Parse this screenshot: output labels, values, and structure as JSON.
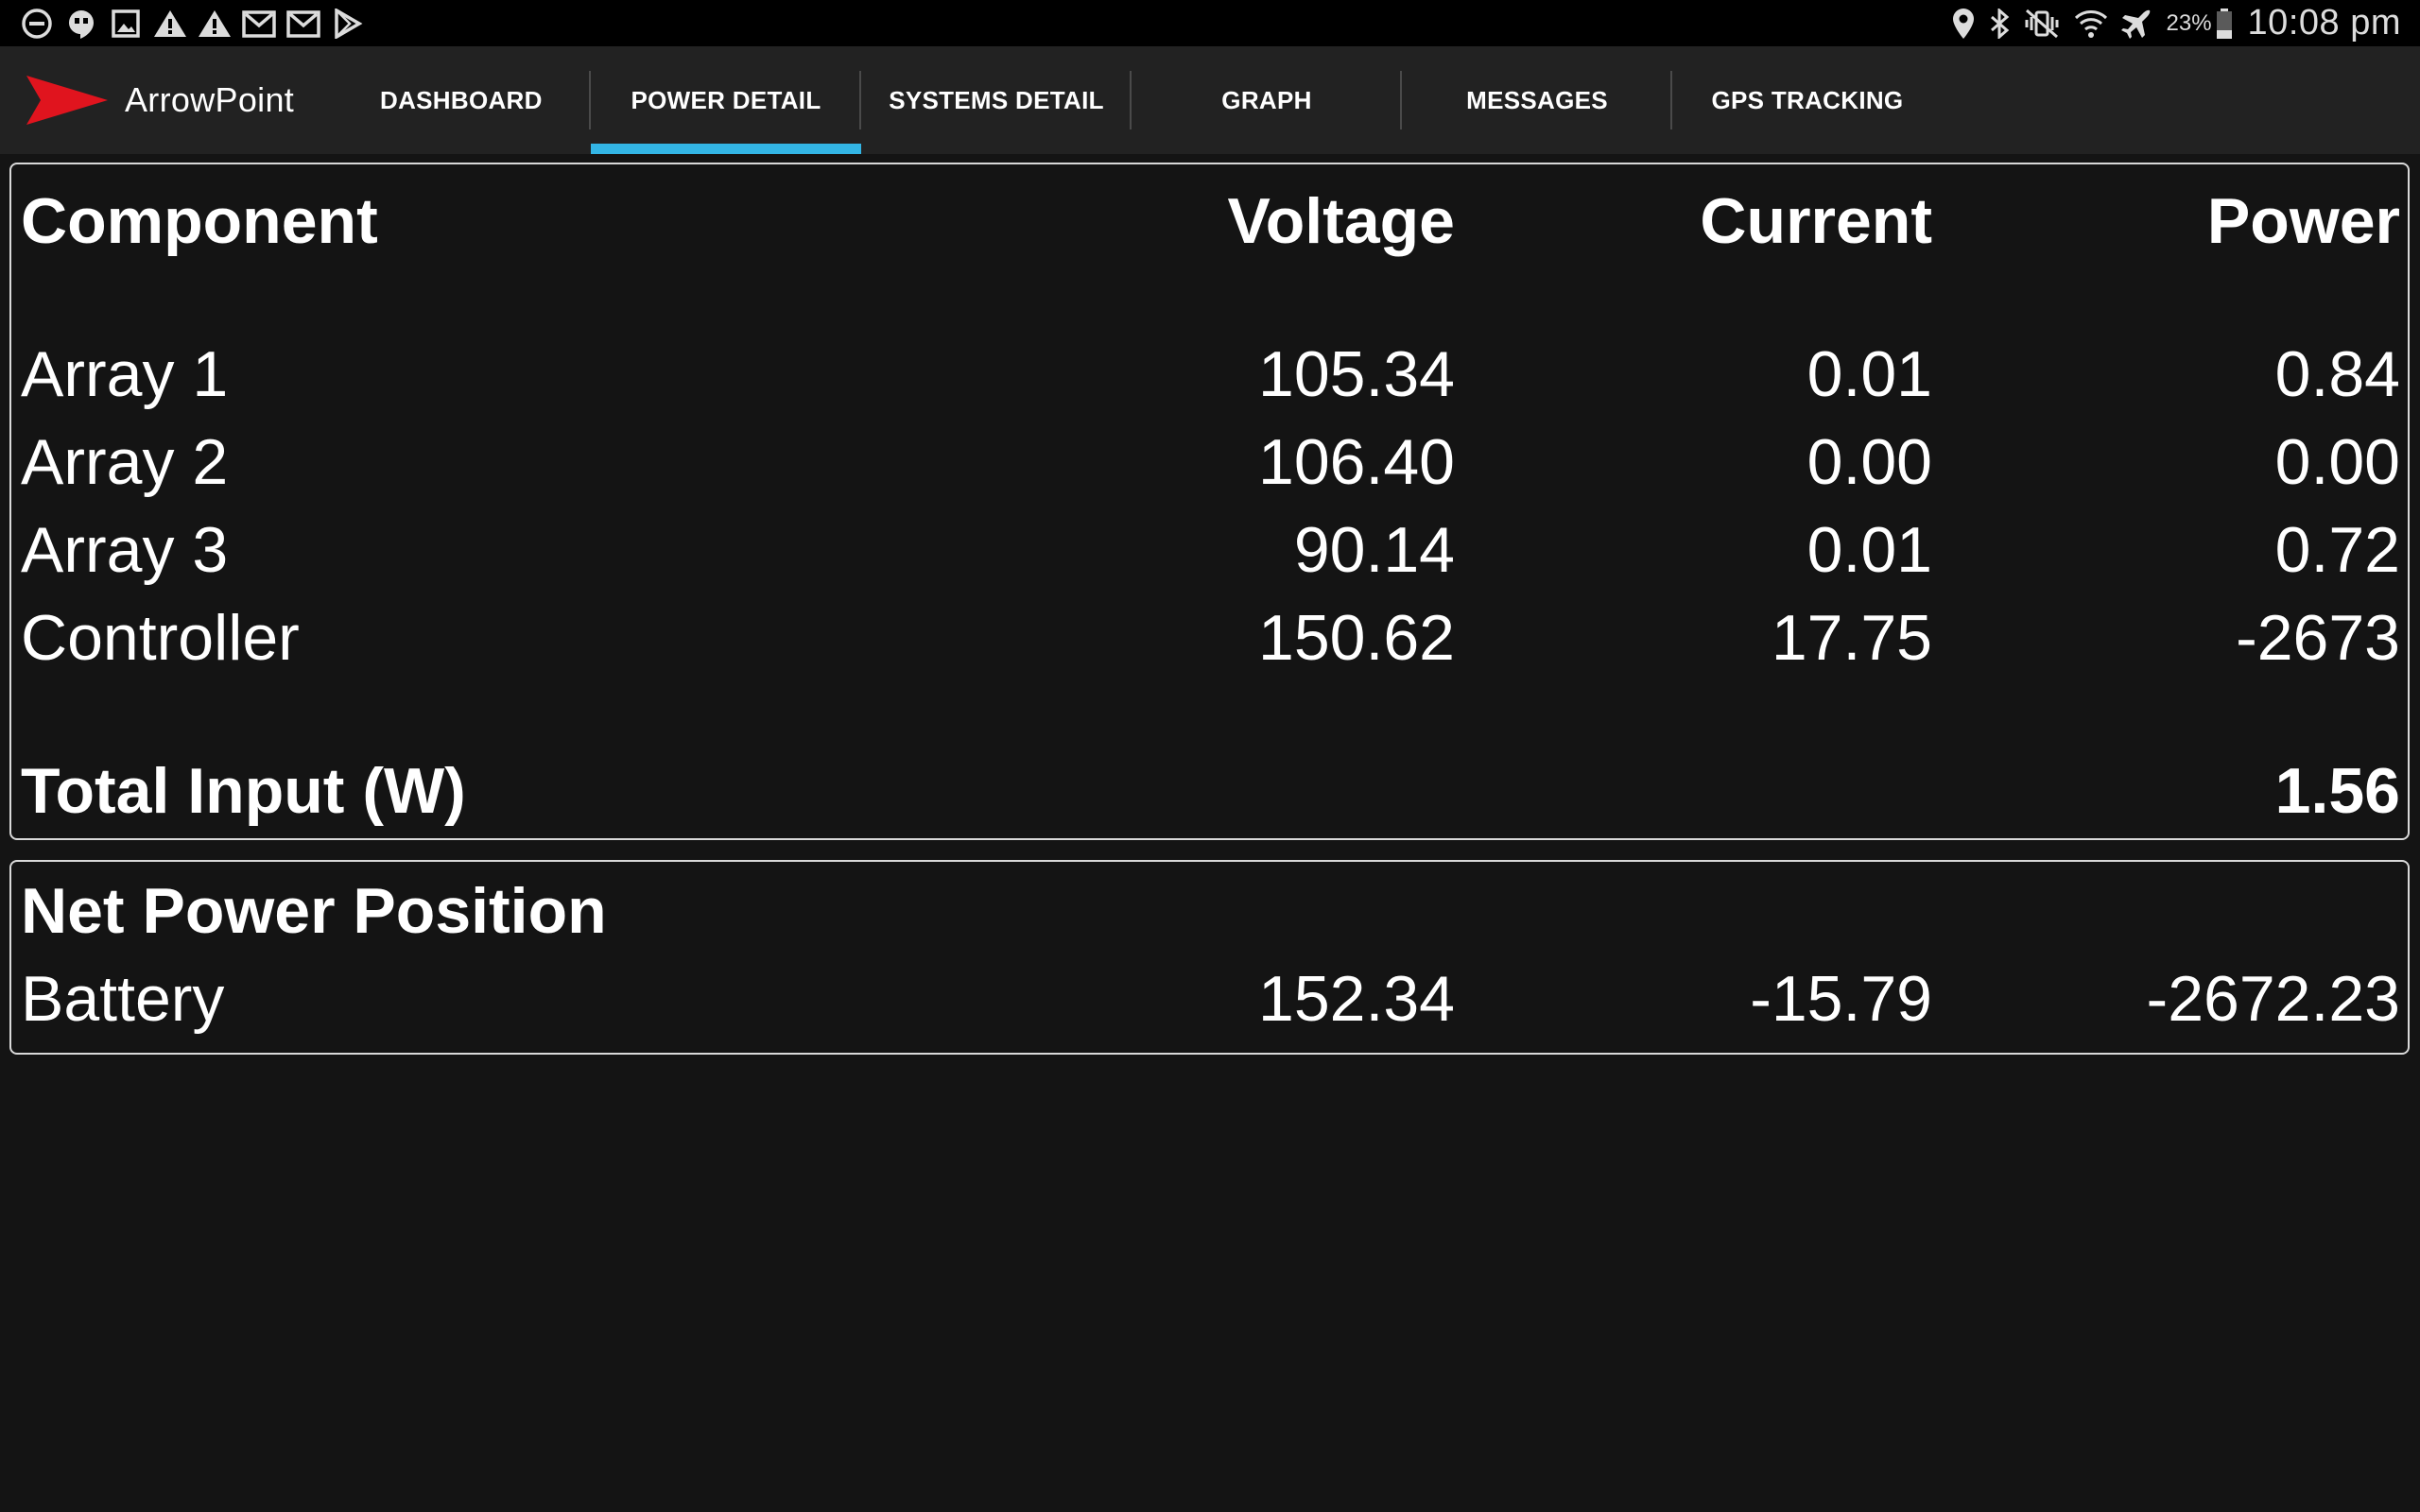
{
  "status_bar": {
    "left_icons": [
      "do-not-disturb-icon",
      "hangouts-icon",
      "gallery-icon",
      "warning-icon",
      "warning-icon",
      "gmail-icon",
      "gmail-icon",
      "play-store-icon"
    ],
    "battery_percent": "23%",
    "time": "10:08 pm"
  },
  "app": {
    "name": "ArrowPoint",
    "brand_color": "#e0141e",
    "accent_color": "#33b5e5"
  },
  "tabs": [
    {
      "label": "DASHBOARD",
      "active": false
    },
    {
      "label": "POWER DETAIL",
      "active": true
    },
    {
      "label": "SYSTEMS DETAIL",
      "active": false
    },
    {
      "label": "GRAPH",
      "active": false
    },
    {
      "label": "MESSAGES",
      "active": false
    },
    {
      "label": "GPS TRACKING",
      "active": false
    }
  ],
  "power_table": {
    "headers": {
      "component": "Component",
      "voltage": "Voltage",
      "current": "Current",
      "power": "Power"
    },
    "rows": [
      {
        "component": "Array 1",
        "voltage": "105.34",
        "current": "0.01",
        "power": "0.84"
      },
      {
        "component": "Array 2",
        "voltage": "106.40",
        "current": "0.00",
        "power": "0.00"
      },
      {
        "component": "Array 3",
        "voltage": "90.14",
        "current": "0.01",
        "power": "0.72"
      },
      {
        "component": "Controller",
        "voltage": "150.62",
        "current": "17.75",
        "power": "-2673"
      }
    ],
    "total": {
      "label": "Total Input (W)",
      "value": "1.56"
    }
  },
  "net_power": {
    "title": "Net Power Position",
    "battery": {
      "label": "Battery",
      "voltage": "152.34",
      "current": "-15.79",
      "power": "-2672.23"
    }
  }
}
